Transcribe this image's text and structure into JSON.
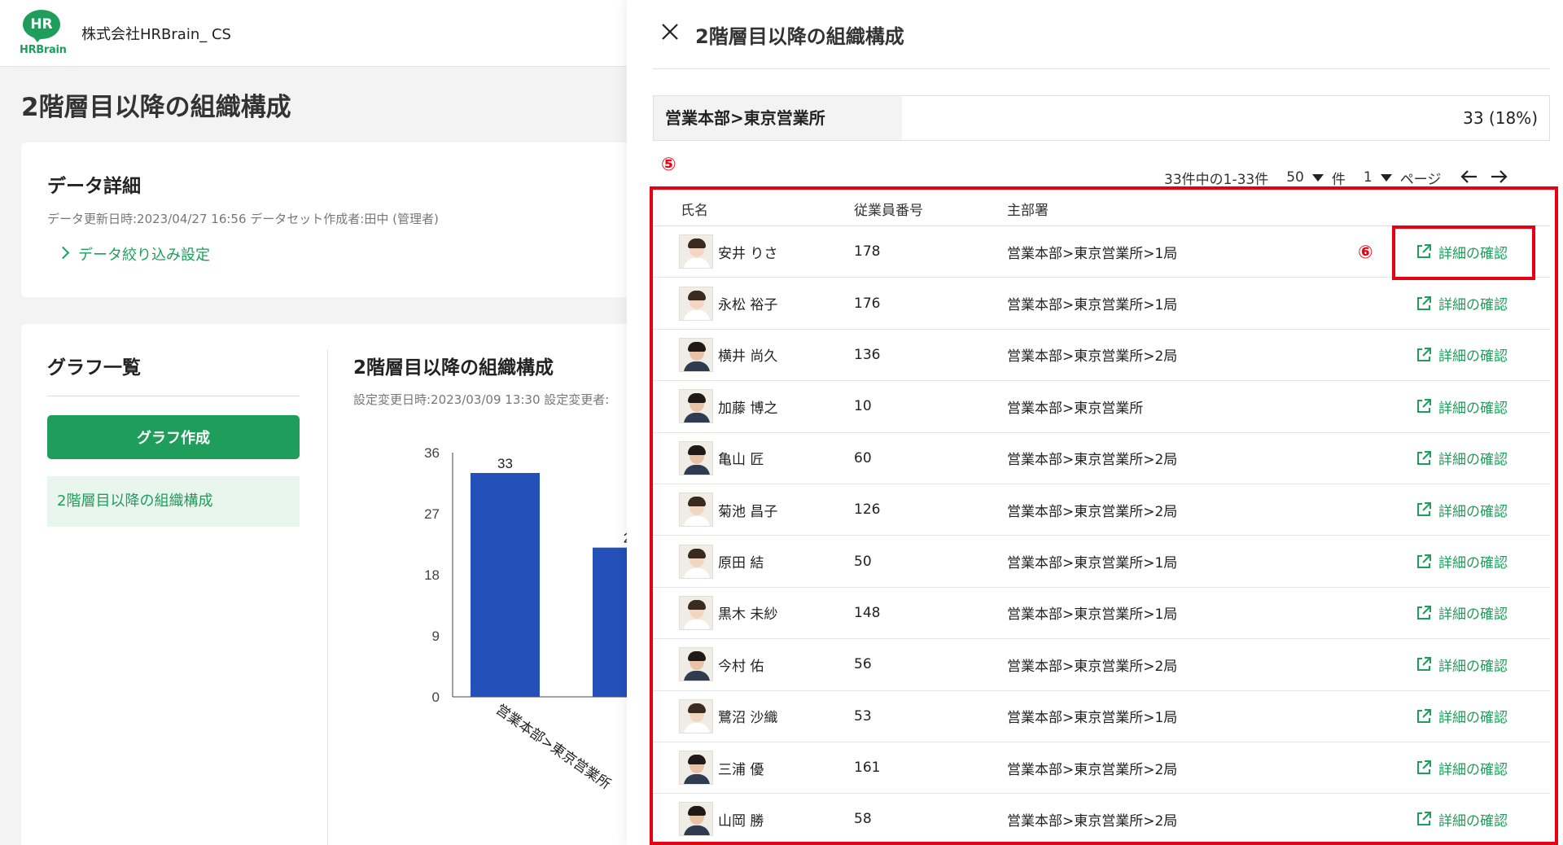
{
  "header": {
    "logo_mark": "HR",
    "logo_text": "HRBrain",
    "company": "株式会社HRBrain_ CS"
  },
  "page": {
    "title": "2階層目以降の組織構成"
  },
  "data_detail": {
    "title": "データ詳細",
    "meta": "データ更新日時:2023/04/27 16:56 データセット作成者:田中 (管理者)",
    "filter_label": "データ絞り込み設定"
  },
  "graph_list": {
    "title": "グラフ一覧",
    "create_button": "グラフ作成",
    "items": [
      "2階層目以降の組織構成"
    ]
  },
  "chart": {
    "title": "2階層目以降の組織構成",
    "meta": "設定変更日時:2023/03/09 13:30 設定変更者:"
  },
  "chart_data": {
    "type": "bar",
    "categories": [
      "営業本部>東京営業所",
      ""
    ],
    "values": [
      33,
      22
    ],
    "value_labels": [
      "33",
      "2"
    ],
    "ylim": [
      0,
      36
    ],
    "yticks": [
      0,
      9,
      18,
      27,
      36
    ],
    "bar_color": "#2450b9",
    "grid": false
  },
  "drawer": {
    "title": "2階層目以降の組織構成",
    "summary_label": "営業本部>東京営業所",
    "summary_value": "33 (18%)",
    "marker_list": "⑤",
    "marker_button": "⑥",
    "pager": {
      "range": "33件中の1-33件",
      "per_page": "50",
      "per_page_unit": "件",
      "page": "1",
      "page_unit": "ページ"
    },
    "columns": {
      "name": "氏名",
      "id": "従業員番号",
      "dept": "主部署"
    },
    "action_label": "詳細の確認",
    "rows": [
      {
        "name": "安井 りさ",
        "id": "178",
        "dept": "営業本部>東京営業所>1局",
        "tone": "f"
      },
      {
        "name": "永松 裕子",
        "id": "176",
        "dept": "営業本部>東京営業所>1局",
        "tone": "f"
      },
      {
        "name": "横井 尚久",
        "id": "136",
        "dept": "営業本部>東京営業所>2局",
        "tone": "m"
      },
      {
        "name": "加藤 博之",
        "id": "10",
        "dept": "営業本部>東京営業所",
        "tone": "m"
      },
      {
        "name": "亀山 匠",
        "id": "60",
        "dept": "営業本部>東京営業所>2局",
        "tone": "m"
      },
      {
        "name": "菊池 昌子",
        "id": "126",
        "dept": "営業本部>東京営業所>2局",
        "tone": "f"
      },
      {
        "name": "原田 結",
        "id": "50",
        "dept": "営業本部>東京営業所>1局",
        "tone": "f"
      },
      {
        "name": "黒木 未紗",
        "id": "148",
        "dept": "営業本部>東京営業所>1局",
        "tone": "f"
      },
      {
        "name": "今村 佑",
        "id": "56",
        "dept": "営業本部>東京営業所>2局",
        "tone": "m"
      },
      {
        "name": "鷺沼 沙織",
        "id": "53",
        "dept": "営業本部>東京営業所>1局",
        "tone": "f"
      },
      {
        "name": "三浦 優",
        "id": "161",
        "dept": "営業本部>東京営業所>2局",
        "tone": "m"
      },
      {
        "name": "山岡 勝",
        "id": "58",
        "dept": "営業本部>東京営業所>2局",
        "tone": "m"
      }
    ]
  },
  "colors": {
    "brand": "#1e9e5a",
    "highlight": "#e60012",
    "bar": "#2450b9"
  }
}
